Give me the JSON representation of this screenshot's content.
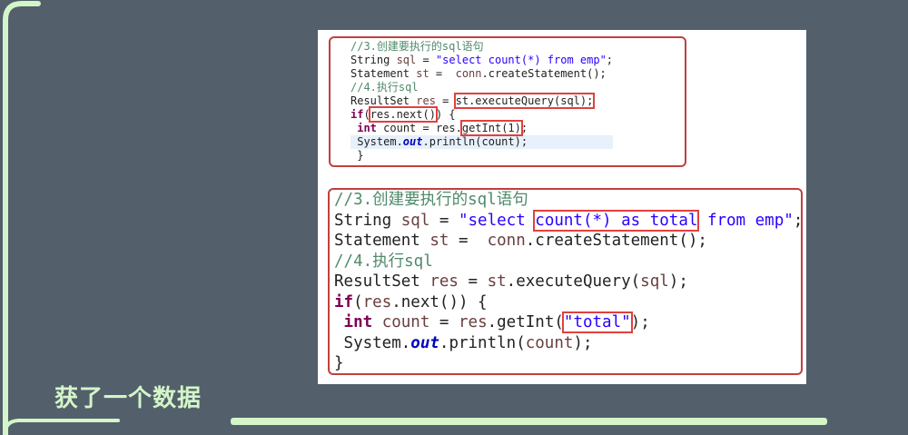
{
  "slide": {
    "caption": "获了一个数据",
    "accent_color": "#d4f5c8",
    "background_color": "#535f6b"
  },
  "code_before": [
    [
      [
        "//3.创建要执行的sql语句",
        "c"
      ]
    ],
    [
      [
        "String ",
        "n"
      ],
      [
        "sql",
        "v"
      ],
      [
        " = ",
        "n"
      ],
      [
        "\"select count(*) from emp\"",
        "s"
      ],
      [
        ";",
        "n"
      ]
    ],
    [
      [
        "Statement ",
        "n"
      ],
      [
        "st",
        "v"
      ],
      [
        " =  ",
        "n"
      ],
      [
        "conn",
        "v"
      ],
      [
        ".createStatement();",
        "n"
      ]
    ],
    [
      [
        "//4.执行sql",
        "c"
      ]
    ],
    [
      [
        "ResultSet ",
        "n"
      ],
      [
        "res",
        "v"
      ],
      [
        " = ",
        "n"
      ],
      [
        "st.executeQuery(sql);",
        "n",
        true
      ]
    ],
    [
      [
        "if",
        "k"
      ],
      [
        "(",
        "n"
      ],
      [
        "res.next()",
        "n",
        true
      ],
      [
        ") {",
        "n"
      ]
    ],
    [
      [
        " ",
        "n"
      ],
      [
        "int",
        "k"
      ],
      [
        " count = res.",
        "n"
      ],
      [
        "getInt(1)",
        "n",
        true
      ],
      [
        ";",
        "n"
      ]
    ],
    [
      [
        " System.",
        "n"
      ],
      [
        "out",
        "f"
      ],
      [
        ".println(count);",
        "n"
      ]
    ],
    [
      [
        " }",
        "n"
      ]
    ]
  ],
  "code_after": [
    [
      [
        "//3.创建要执行的sql语句",
        "c"
      ]
    ],
    [
      [
        "String ",
        "n"
      ],
      [
        "sql",
        "v"
      ],
      [
        " = ",
        "n"
      ],
      [
        "\"select ",
        "s"
      ],
      [
        "count(*) as total",
        "s",
        true
      ],
      [
        " from emp\"",
        "s"
      ],
      [
        ";",
        "n"
      ]
    ],
    [
      [
        "Statement ",
        "n"
      ],
      [
        "st",
        "v"
      ],
      [
        " =  ",
        "n"
      ],
      [
        "conn",
        "v"
      ],
      [
        ".createStatement();",
        "n"
      ]
    ],
    [
      [
        "//4.执行sql",
        "c"
      ]
    ],
    [
      [
        "ResultSet ",
        "n"
      ],
      [
        "res",
        "v"
      ],
      [
        " = ",
        "n"
      ],
      [
        "st",
        "v"
      ],
      [
        ".executeQuery(",
        "n"
      ],
      [
        "sql",
        "v"
      ],
      [
        ");",
        "n"
      ]
    ],
    [
      [
        "if",
        "k"
      ],
      [
        "(",
        "n"
      ],
      [
        "res",
        "v"
      ],
      [
        ".next()) {",
        "n"
      ]
    ],
    [
      [
        " ",
        "n"
      ],
      [
        "int",
        "k"
      ],
      [
        " ",
        "n"
      ],
      [
        "count",
        "v"
      ],
      [
        " = ",
        "n"
      ],
      [
        "res",
        "v"
      ],
      [
        ".getInt(",
        "n"
      ],
      [
        "\"total\"",
        "s",
        true
      ],
      [
        ");",
        "n"
      ]
    ],
    [
      [
        " System.",
        "n"
      ],
      [
        "out",
        "f"
      ],
      [
        ".println(",
        "n"
      ],
      [
        "count",
        "v"
      ],
      [
        ");",
        "n"
      ]
    ],
    [
      [
        "}",
        "n"
      ]
    ]
  ]
}
